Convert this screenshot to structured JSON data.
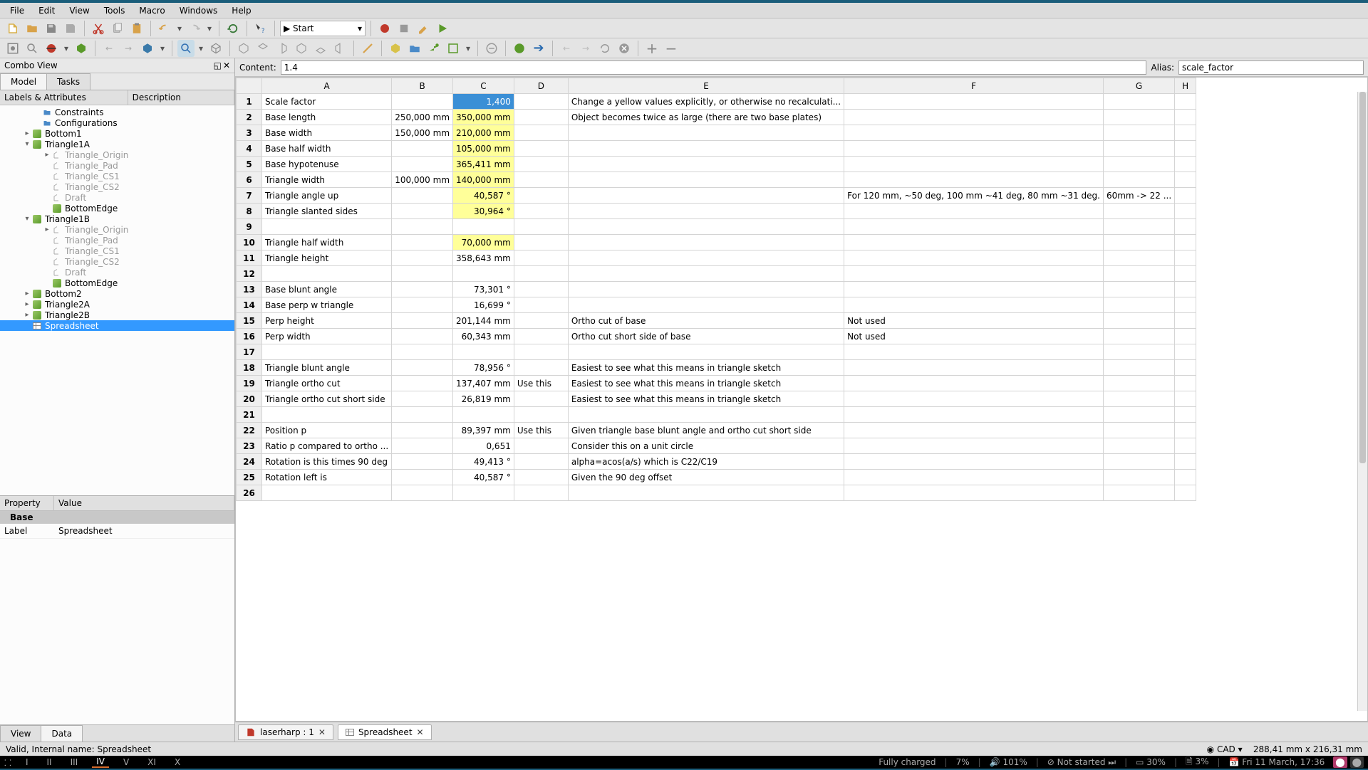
{
  "menubar": [
    "File",
    "Edit",
    "View",
    "Tools",
    "Macro",
    "Windows",
    "Help"
  ],
  "macro_select": "▶ Start",
  "content_label": "Content:",
  "content_value": "1.4",
  "alias_label": "Alias:",
  "alias_value": "scale_factor",
  "combo_title": "Combo View",
  "tabs": {
    "model": "Model",
    "tasks": "Tasks"
  },
  "tree_headers": {
    "labels": "Labels & Attributes",
    "desc": "Description"
  },
  "tree": [
    {
      "d": 3,
      "e": "",
      "i": "folder",
      "t": "Constraints",
      "dim": false
    },
    {
      "d": 3,
      "e": "",
      "i": "folder",
      "t": "Configurations",
      "dim": false
    },
    {
      "d": 2,
      "e": "▸",
      "i": "cube",
      "t": "Bottom1",
      "dim": false
    },
    {
      "d": 2,
      "e": "▾",
      "i": "cube",
      "t": "Triangle1A",
      "dim": false
    },
    {
      "d": 4,
      "e": "▸",
      "i": "axis",
      "t": "Triangle_Origin",
      "dim": true
    },
    {
      "d": 4,
      "e": "",
      "i": "axis",
      "t": "Triangle_Pad",
      "dim": true
    },
    {
      "d": 4,
      "e": "",
      "i": "axis",
      "t": "Triangle_CS1",
      "dim": true
    },
    {
      "d": 4,
      "e": "",
      "i": "axis",
      "t": "Triangle_CS2",
      "dim": true
    },
    {
      "d": 4,
      "e": "",
      "i": "axis",
      "t": "Draft",
      "dim": true
    },
    {
      "d": 4,
      "e": "",
      "i": "cube",
      "t": "BottomEdge",
      "dim": false
    },
    {
      "d": 2,
      "e": "▾",
      "i": "cube",
      "t": "Triangle1B",
      "dim": false
    },
    {
      "d": 4,
      "e": "▸",
      "i": "axis",
      "t": "Triangle_Origin",
      "dim": true
    },
    {
      "d": 4,
      "e": "",
      "i": "axis",
      "t": "Triangle_Pad",
      "dim": true
    },
    {
      "d": 4,
      "e": "",
      "i": "axis",
      "t": "Triangle_CS1",
      "dim": true
    },
    {
      "d": 4,
      "e": "",
      "i": "axis",
      "t": "Triangle_CS2",
      "dim": true
    },
    {
      "d": 4,
      "e": "",
      "i": "axis",
      "t": "Draft",
      "dim": true
    },
    {
      "d": 4,
      "e": "",
      "i": "cube",
      "t": "BottomEdge",
      "dim": false
    },
    {
      "d": 2,
      "e": "▸",
      "i": "cube",
      "t": "Bottom2",
      "dim": false
    },
    {
      "d": 2,
      "e": "▸",
      "i": "cube",
      "t": "Triangle2A",
      "dim": false
    },
    {
      "d": 2,
      "e": "▸",
      "i": "cube",
      "t": "Triangle2B",
      "dim": false
    },
    {
      "d": 2,
      "e": "",
      "i": "sheet",
      "t": "Spreadsheet",
      "dim": false,
      "sel": true
    }
  ],
  "prop_headers": {
    "prop": "Property",
    "val": "Value"
  },
  "prop_cat": "Base",
  "props": [
    {
      "k": "Label",
      "v": "Spreadsheet"
    }
  ],
  "bottom_tabs": {
    "view": "View",
    "data": "Data"
  },
  "columns": [
    "A",
    "B",
    "C",
    "D",
    "E",
    "F",
    "G",
    "H"
  ],
  "rows": [
    {
      "n": 1,
      "A": "Scale factor",
      "C": "1,400",
      "Csel": true,
      "E": "Change a yellow values explicitly, or otherwise no recalculati..."
    },
    {
      "n": 2,
      "A": "Base length",
      "B": "250,000 mm",
      "C": "350,000 mm",
      "Cy": true,
      "E": "Object becomes twice as large (there are two base plates)"
    },
    {
      "n": 3,
      "A": "Base width",
      "B": "150,000 mm",
      "C": "210,000 mm",
      "Cy": true
    },
    {
      "n": 4,
      "A": "Base half width",
      "C": "105,000 mm",
      "Cy": true
    },
    {
      "n": 5,
      "A": "Base hypotenuse",
      "C": "365,411 mm",
      "Cy": true
    },
    {
      "n": 6,
      "A": "Triangle width",
      "B": "100,000 mm",
      "C": "140,000 mm",
      "Cy": true
    },
    {
      "n": 7,
      "A": "Triangle angle up",
      "C": "40,587 °",
      "Cy": true,
      "F": "For 120 mm, ~50 deg, 100 mm ~41 deg, 80 mm ~31 deg.",
      "G": "60mm -> 22 ..."
    },
    {
      "n": 8,
      "A": "Triangle slanted sides",
      "C": "30,964 °",
      "Cy": true
    },
    {
      "n": 9
    },
    {
      "n": 10,
      "A": "Triangle half width",
      "C": "70,000 mm",
      "Cy": true
    },
    {
      "n": 11,
      "A": "Triangle height",
      "C": "358,643 mm"
    },
    {
      "n": 12
    },
    {
      "n": 13,
      "A": "Base blunt angle",
      "C": "73,301 °"
    },
    {
      "n": 14,
      "A": "Base perp w triangle",
      "C": "16,699 °"
    },
    {
      "n": 15,
      "A": "Perp height",
      "C": "201,144 mm",
      "E": "Ortho cut of base",
      "F": "Not used"
    },
    {
      "n": 16,
      "A": "Perp width",
      "C": "60,343 mm",
      "E": "Ortho cut short side of base",
      "F": "Not used"
    },
    {
      "n": 17
    },
    {
      "n": 18,
      "A": "Triangle blunt angle",
      "C": "78,956 °",
      "E": "Easiest to see what this means in triangle sketch"
    },
    {
      "n": 19,
      "A": "Triangle ortho cut",
      "C": "137,407 mm",
      "D": "Use this",
      "E": "Easiest to see what this means in triangle sketch"
    },
    {
      "n": 20,
      "A": "Triangle ortho cut short side",
      "C": "26,819 mm",
      "E": "Easiest to see what this means in triangle sketch"
    },
    {
      "n": 21
    },
    {
      "n": 22,
      "A": "Position p",
      "C": "89,397 mm",
      "D": "Use this",
      "E": "Given triangle base blunt angle and ortho cut short side"
    },
    {
      "n": 23,
      "A": "Ratio p compared to ortho ...",
      "C": "0,651",
      "E": "Consider this on a unit circle"
    },
    {
      "n": 24,
      "A": "Rotation is this times 90 deg",
      "C": "49,413 °",
      "E": "alpha=acos(a/s) which is C22/C19"
    },
    {
      "n": 25,
      "A": "Rotation left is",
      "C": "40,587 °",
      "E": "Given the 90 deg offset"
    },
    {
      "n": 26
    }
  ],
  "doc_tabs": [
    {
      "label": "laserharp : 1",
      "active": false,
      "ico": "doc"
    },
    {
      "label": "Spreadsheet",
      "active": true,
      "ico": "sheet"
    }
  ],
  "status_left": "Valid, Internal name: Spreadsheet",
  "status_right_nav": "CAD",
  "status_right_dims": "288,41 mm x 216,31 mm",
  "taskbar": {
    "workspaces": [
      "I",
      "II",
      "III",
      "IV",
      "V",
      "XI",
      "X"
    ],
    "active_ws": 3,
    "items": [
      "Fully charged",
      "7%",
      "🔊 101%",
      "⊘ Not started ⏭",
      "▭ 30%",
      "🗎 3%",
      "📅 Fri 11 March, 17:36"
    ]
  }
}
